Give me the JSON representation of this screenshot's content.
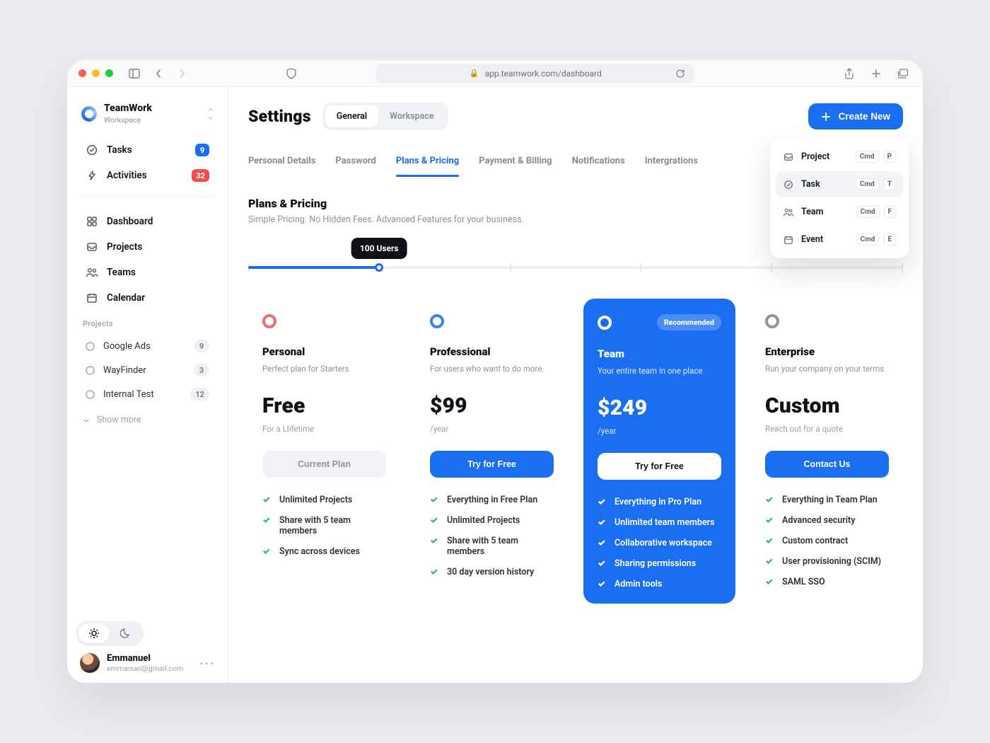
{
  "browser": {
    "url": "app.teamwork.com/dashboard"
  },
  "workspace": {
    "name": "TeamWork",
    "sub": "Workspace"
  },
  "sidebar": {
    "top": [
      {
        "label": "Tasks",
        "badge": "9",
        "badgeStyle": "blue"
      },
      {
        "label": "Activities",
        "badge": "32",
        "badgeStyle": "red"
      }
    ],
    "nav": [
      {
        "label": "Dashboard"
      },
      {
        "label": "Projects"
      },
      {
        "label": "Teams"
      },
      {
        "label": "Calendar"
      }
    ],
    "projects_title": "Projects",
    "projects": [
      {
        "label": "Google Ads",
        "count": "9"
      },
      {
        "label": "WayFinder",
        "count": "3"
      },
      {
        "label": "Internal Test",
        "count": "12"
      }
    ],
    "show_more": "Show more"
  },
  "header": {
    "title": "Settings",
    "seg": [
      "General",
      "Workspace"
    ],
    "create": "Create New"
  },
  "tabs": [
    "Personal Details",
    "Password",
    "Plans & Pricing",
    "Payment & Billing",
    "Notifications",
    "Intergrations"
  ],
  "section": {
    "title": "Plans & Pricing",
    "sub": "Simple Pricing. No Hidden Fees. Advanced Features for your business."
  },
  "slider": {
    "tooltip": "100 Users",
    "percent": 20
  },
  "popover": {
    "items": [
      {
        "label": "Project",
        "cmd": "Cmd",
        "key": "P"
      },
      {
        "label": "Task",
        "cmd": "Cmd",
        "key": "T",
        "sel": true
      },
      {
        "label": "Team",
        "cmd": "Cmd",
        "key": "F"
      },
      {
        "label": "Event",
        "cmd": "Cmd",
        "key": "E"
      }
    ]
  },
  "plans": [
    {
      "name": "Personal",
      "desc": "Perfect plan for Starters",
      "price": "Free",
      "period": "For a Llifetime",
      "cta": "Current Plan",
      "ctaStyle": "cta-muted",
      "ring": "pink",
      "features": [
        "Unlimited Projects",
        "Share with 5 team members",
        "Sync across devices"
      ]
    },
    {
      "name": "Professional",
      "desc": "For users who want to do more.",
      "price": "$99",
      "period": "/year",
      "cta": "Try for Free",
      "ctaStyle": "cta-blue",
      "ring": "blue",
      "features": [
        "Everything in Free Plan",
        "Unlimited Projects",
        "Share with 5 team members",
        "30 day version history"
      ]
    },
    {
      "name": "Team",
      "desc": "Your entire team in one place",
      "price": "$249",
      "period": "/year",
      "cta": "Try for Free",
      "ctaStyle": "cta-white",
      "ring": "white",
      "highlight": true,
      "rec": "Recommended",
      "features": [
        "Everything in Pro Plan",
        "Unlimited team members",
        "Collaborative workspace",
        "Sharing permissions",
        "Admin tools"
      ]
    },
    {
      "name": "Enterprise",
      "desc": "Run your company on your terms",
      "price": "Custom",
      "period": "Reach out for a quote",
      "cta": "Contact Us",
      "ctaStyle": "cta-blue",
      "ring": "grey",
      "features": [
        "Everything in Team Plan",
        "Advanced security",
        "Custom contract",
        "User provisioning (SCIM)",
        "SAML SSO"
      ]
    }
  ],
  "user": {
    "name": "Emmanuel",
    "email": "emmanuel@gmail.com"
  }
}
